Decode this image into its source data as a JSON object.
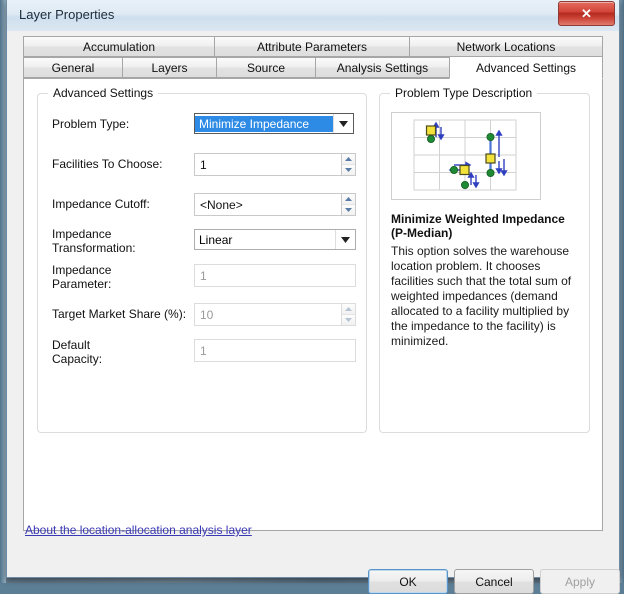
{
  "window": {
    "title": "Layer Properties",
    "close_label": "✕"
  },
  "tabs": {
    "row1": [
      {
        "label": "Accumulation",
        "active": false
      },
      {
        "label": "Attribute Parameters",
        "active": false
      },
      {
        "label": "Network Locations",
        "active": false
      }
    ],
    "row2": [
      {
        "label": "General",
        "active": false
      },
      {
        "label": "Layers",
        "active": false
      },
      {
        "label": "Source",
        "active": false
      },
      {
        "label": "Analysis Settings",
        "active": false
      },
      {
        "label": "Advanced Settings",
        "active": true
      }
    ]
  },
  "advanced_settings": {
    "group_title": "Advanced Settings",
    "fields": {
      "problem_type": {
        "label": "Problem Type:",
        "value": "Minimize Impedance",
        "selected": true
      },
      "facilities_to_choose": {
        "label": "Facilities To Choose:",
        "value": "1",
        "disabled": false
      },
      "impedance_cutoff": {
        "label": "Impedance Cutoff:",
        "value": "<None>",
        "disabled": false
      },
      "impedance_transformation": {
        "label_line1": "Impedance",
        "label_line2": "Transformation:",
        "value": "Linear"
      },
      "impedance_parameter": {
        "label_line1": "Impedance",
        "label_line2": "Parameter:",
        "value": "1",
        "disabled": true
      },
      "target_market_share": {
        "label": "Target Market Share (%):",
        "value": "10",
        "disabled": true
      },
      "default_capacity": {
        "label_line1": "Default",
        "label_line2": "Capacity:",
        "value": "1",
        "disabled": true
      }
    }
  },
  "problem_type_description": {
    "group_title": "Problem Type Description",
    "heading_line1": "Minimize Weighted Impedance",
    "heading_line2": "(P-Median)",
    "body": "This option solves the warehouse location problem. It chooses facilities such that the total sum of weighted impedances (demand allocated to a facility multiplied by the impedance to the facility) is minimized."
  },
  "about_link": "About the location-allocation analysis layer",
  "buttons": {
    "ok": "OK",
    "cancel": "Cancel",
    "apply": "Apply"
  },
  "colors": {
    "accent_selection": "#2d8ae5",
    "link": "#3a39b5",
    "close_red": "#c93a2c",
    "facility_yellow": "#f2e23a",
    "demand_green": "#1f8a34",
    "connector_blue": "#3b5fd6"
  }
}
